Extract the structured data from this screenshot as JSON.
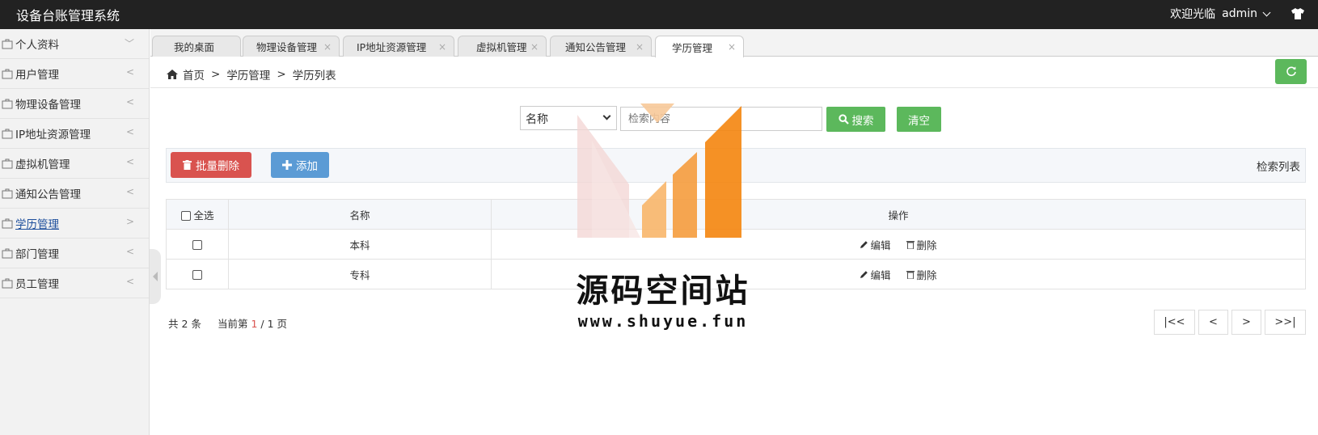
{
  "app": {
    "title": "设备台账管理系统",
    "welcome": "欢迎光临",
    "user": "admin"
  },
  "sidebar": {
    "items": [
      {
        "label": "个人资料",
        "arrow": "﹀"
      },
      {
        "label": "用户管理",
        "arrow": "<"
      },
      {
        "label": "物理设备管理",
        "arrow": "<"
      },
      {
        "label": "IP地址资源管理",
        "arrow": "<"
      },
      {
        "label": "虚拟机管理",
        "arrow": "<"
      },
      {
        "label": "通知公告管理",
        "arrow": "<"
      },
      {
        "label": "学历管理",
        "arrow": ">"
      },
      {
        "label": "部门管理",
        "arrow": "<"
      },
      {
        "label": "员工管理",
        "arrow": "<"
      }
    ],
    "active_index": 6
  },
  "tabs": [
    {
      "label": "我的桌面",
      "close": ""
    },
    {
      "label": "物理设备管理",
      "close": "×"
    },
    {
      "label": "IP地址资源管理",
      "close": "×"
    },
    {
      "label": "虚拟机管理",
      "close": "×"
    },
    {
      "label": "通知公告管理",
      "close": "×"
    },
    {
      "label": "学历管理",
      "close": "×"
    }
  ],
  "breadcrumb": {
    "home": "首页",
    "sep": ">",
    "level1": "学历管理",
    "level2": "学历列表"
  },
  "search": {
    "field_selected": "名称",
    "placeholder": "检索内容",
    "search_label": "搜索",
    "clear_label": "清空"
  },
  "toolbar": {
    "batch_delete_label": "批量删除",
    "add_label": "添加",
    "list_title": "检索列表"
  },
  "table": {
    "headers": {
      "select_all": "全选",
      "name": "名称",
      "actions": "操作"
    },
    "rows": [
      {
        "name": "本科",
        "edit": "编辑",
        "delete": "删除"
      },
      {
        "name": "专科",
        "edit": "编辑",
        "delete": "删除"
      }
    ]
  },
  "pagination": {
    "total_prefix": "共",
    "total": "2",
    "total_suffix": "条",
    "current_prefix": "当前第",
    "current": "1",
    "slash": "/",
    "pages": "1",
    "pages_suffix": "页",
    "first": "|<<",
    "prev": "<",
    "next": ">",
    "last": ">>|"
  },
  "watermark": {
    "name": "源码空间站",
    "url": "www.shuyue.fun"
  },
  "colors": {
    "topbar": "#222222",
    "green": "#5cb85c",
    "red": "#d9534f",
    "blue": "#5b9bd5",
    "active_link": "#1e4f9c"
  }
}
